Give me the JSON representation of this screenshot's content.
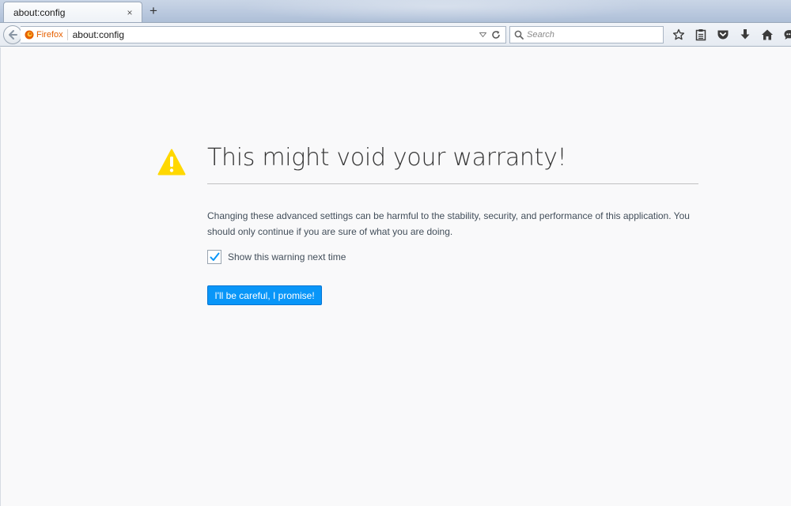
{
  "tab": {
    "title": "about:config",
    "close_symbol": "×",
    "new_tab_symbol": "+"
  },
  "navbar": {
    "identity_label": "Firefox",
    "url": "about:config",
    "search_placeholder": "Search",
    "icons": [
      "bookmark-star-icon",
      "reading-list-icon",
      "pocket-icon",
      "downloads-icon",
      "home-icon",
      "chat-icon"
    ]
  },
  "page": {
    "title": "This might void your warranty!",
    "description": "Changing these advanced settings can be harmful to the stability, security, and performance of this application. You should only continue if you are sure of what you are doing.",
    "checkbox_label": "Show this warning next time",
    "checkbox_checked": true,
    "button_label": "I'll be careful, I promise!"
  },
  "colors": {
    "accent_button": "#0996f8",
    "warning_icon": "#ffd800",
    "identity_orange": "#e66000",
    "checkmark": "#0996f8"
  }
}
